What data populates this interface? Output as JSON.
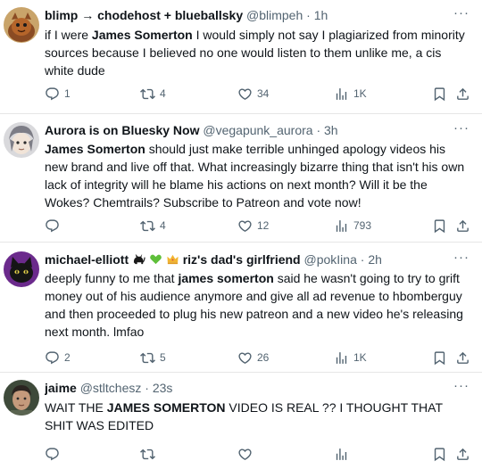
{
  "tweets": [
    {
      "display_name": "blimp → chodehost + blueballsky",
      "handle": "@blimpeh",
      "time": "1h",
      "text_parts": [
        "if I were ",
        "James Somerton",
        " I would simply not say I plagiarized from minority sources because I believed no one would listen to them unlike me, a cis white dude"
      ],
      "replies": "1",
      "retweets": "4",
      "likes": "34",
      "views": "1K"
    },
    {
      "display_name": "Aurora is on Bluesky Now",
      "handle": "@vegapunk_aurora",
      "time": "3h",
      "text_parts": [
        "",
        "James Somerton",
        " should just make terrible unhinged apology videos his new brand and live off that. What increasingly bizarre thing that isn't his own lack of integrity will he blame his actions on next month? Will it be the Wokes? Chemtrails? Subscribe to Patreon and vote now!"
      ],
      "replies": "",
      "retweets": "4",
      "likes": "12",
      "views": "793"
    },
    {
      "display_name": "michael-elliott",
      "display_name_2": "riz's dad's girlfriend",
      "handle": "@pokIina",
      "time": "2h",
      "text_parts": [
        "deeply funny to me that ",
        "james somerton",
        " said he wasn't going to try to grift money out of his audience anymore and give all ad revenue to hbomberguy and then proceeded to plug his new patreon and a new video he's releasing next month. lmfao"
      ],
      "replies": "2",
      "retweets": "5",
      "likes": "26",
      "views": "1K"
    },
    {
      "display_name": "jaime",
      "handle": "@stltchesz",
      "time": "23s",
      "text_parts": [
        "WAIT THE ",
        "JAMES SOMERTON",
        " VIDEO IS REAL ?? I THOUGHT THAT SHIT WAS EDITED"
      ],
      "replies": "",
      "retweets": "",
      "likes": "",
      "views": ""
    }
  ],
  "icons": {
    "more": "more-dots-icon",
    "reply": "reply-icon",
    "retweet": "retweet-icon",
    "like": "heart-icon",
    "views": "views-chart-icon",
    "bookmark": "bookmark-icon",
    "share": "share-icon"
  },
  "colors": {
    "text": "#0f1419",
    "muted": "#536471",
    "divider": "#e6e6e6"
  }
}
